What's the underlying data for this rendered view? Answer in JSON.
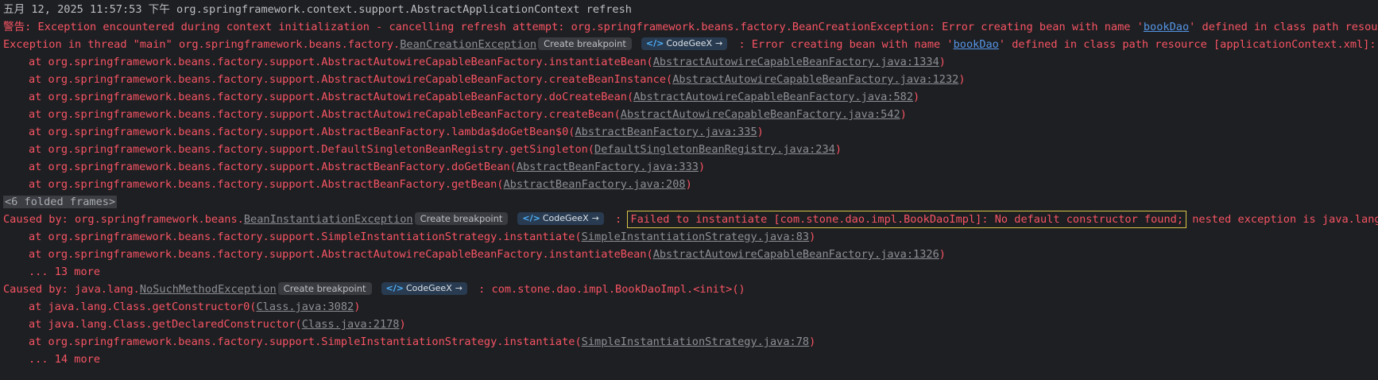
{
  "lines": {
    "l1": "五月 12, 2025 11:57:53 下午 org.springframework.context.support.AbstractApplicationContext refresh",
    "l2_pre": "警告: Exception encountered during context initialization - cancelling refresh attempt: org.springframework.beans.factory.BeanCreationException: Error creating bean with name '",
    "l2_link": "bookDao",
    "l2_post": "' defined in class path resource [applicationContext.xml]",
    "l3_pre": "Exception in thread \"main\" org.springframework.beans.factory.",
    "l3_link": "BeanCreationException",
    "l3_post_pre": " : Error creating bean with name '",
    "l3_link2": "bookDao",
    "l3_post": "' defined in class path resource [applicationContext.xml]: Instantiation of bean failed",
    "s1_pre": "at org.springframework.beans.factory.support.AbstractAutowireCapableBeanFactory.instantiateBean(",
    "s1_link": "AbstractAutowireCapableBeanFactory.java:1334",
    "s2_pre": "at org.springframework.beans.factory.support.AbstractAutowireCapableBeanFactory.createBeanInstance(",
    "s2_link": "AbstractAutowireCapableBeanFactory.java:1232",
    "s3_pre": "at org.springframework.beans.factory.support.AbstractAutowireCapableBeanFactory.doCreateBean(",
    "s3_link": "AbstractAutowireCapableBeanFactory.java:582",
    "s4_pre": "at org.springframework.beans.factory.support.AbstractAutowireCapableBeanFactory.createBean(",
    "s4_link": "AbstractAutowireCapableBeanFactory.java:542",
    "s5_pre": "at org.springframework.beans.factory.support.AbstractBeanFactory.lambda$doGetBean$0(",
    "s5_link": "AbstractBeanFactory.java:335",
    "s6_pre": "at org.springframework.beans.factory.support.DefaultSingletonBeanRegistry.getSingleton(",
    "s6_link": "DefaultSingletonBeanRegistry.java:234",
    "s7_pre": "at org.springframework.beans.factory.support.AbstractBeanFactory.doGetBean(",
    "s7_link": "AbstractBeanFactory.java:333",
    "s8_pre": "at org.springframework.beans.factory.support.AbstractBeanFactory.getBean(",
    "s8_link": "AbstractBeanFactory.java:208",
    "folded": "<6 folded frames>",
    "c1_pre": "Caused by: org.springframework.beans.",
    "c1_link": "BeanInstantiationException",
    "c1_sep": " : ",
    "c1_hl": "Failed to instantiate [com.stone.dao.impl.BookDaoImpl]: No default constructor found;",
    "c1_post": " nested exception is java.lang.NoSuchMethodException",
    "t1_pre": "at org.springframework.beans.factory.support.SimpleInstantiationStrategy.instantiate(",
    "t1_link": "SimpleInstantiationStrategy.java:83",
    "t2_pre": "at org.springframework.beans.factory.support.AbstractAutowireCapableBeanFactory.instantiateBean(",
    "t2_link": "AbstractAutowireCapableBeanFactory.java:1326",
    "more1": "... 13 more",
    "c2_pre": "Caused by: java.lang.",
    "c2_link": "NoSuchMethodException",
    "c2_post": " : com.stone.dao.impl.BookDaoImpl.<init>()",
    "u1_pre": "at java.lang.Class.getConstructor0(",
    "u1_link": "Class.java:3082",
    "u2_pre": "at java.lang.Class.getDeclaredConstructor(",
    "u2_link": "Class.java:2178",
    "u3_pre": "at org.springframework.beans.factory.support.SimpleInstantiationStrategy.instantiate(",
    "u3_link": "SimpleInstantiationStrategy.java:78",
    "more2": "... 14 more"
  },
  "buttons": {
    "create_breakpoint": "Create breakpoint",
    "codegeex": "CodeGeeX"
  },
  "icons": {
    "codegeex": "codegeex-logo-icon",
    "arrow": "arrow-right-icon"
  }
}
